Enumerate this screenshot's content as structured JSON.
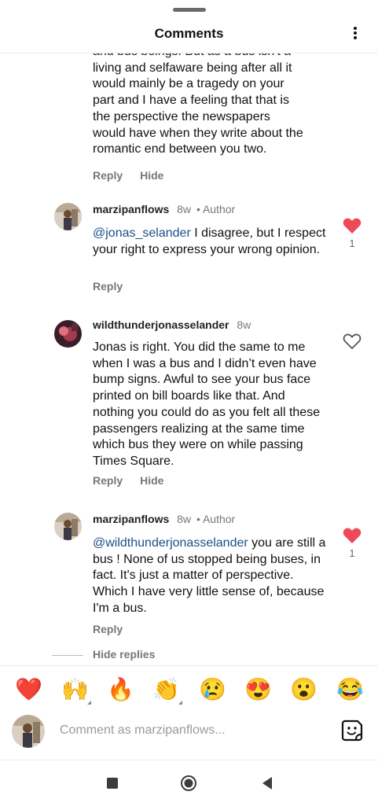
{
  "header": {
    "title": "Comments"
  },
  "continued_comment": {
    "lines": [
      "and bus beings. But as a bus isn't a",
      "living and selfaware being after all it",
      "would mainly be a tragedy on your",
      "part and I have a feeling that that is",
      "the perspective the newspapers",
      "would have when they write about the",
      "romantic end between you two."
    ],
    "reply_label": "Reply",
    "hide_label": "Hide"
  },
  "comments": [
    {
      "username": "marzipanflows",
      "time": "8w",
      "author_label": "Author",
      "mention": "@jonas_selander",
      "text": " I disagree, but I respect your right to express your wrong opinion.",
      "reply_label": "Reply",
      "liked": true,
      "like_count": "1"
    },
    {
      "username": "wildthunderjonasselander",
      "time": "8w",
      "text": "Jonas is right. You did the same to me when I was a bus and I didn’t even have bump signs. Awful to see your bus face printed on bill boards like that. And nothing you could do as you felt all these passengers realizing at the same time which bus they were on while passing Times Square.",
      "reply_label": "Reply",
      "hide_label": "Hide",
      "liked": false
    },
    {
      "username": "marzipanflows",
      "time": "8w",
      "author_label": "Author",
      "mention": "@wildthunderjonasselander",
      "text": " you are still a bus ! None of us stopped being buses, in fact. It's just a matter of perspective. Which I have very little sense of, because I'm a bus.",
      "reply_label": "Reply",
      "liked": true,
      "like_count": "1"
    }
  ],
  "hide_replies_label": "Hide replies",
  "emoji_bar": [
    {
      "icon": "red-heart",
      "glyph": "❤️",
      "variants": false
    },
    {
      "icon": "raising-hands",
      "glyph": "🙌",
      "variants": true
    },
    {
      "icon": "fire",
      "glyph": "🔥",
      "variants": false
    },
    {
      "icon": "clapping-hands",
      "glyph": "👏",
      "variants": true
    },
    {
      "icon": "crying-face",
      "glyph": "😢",
      "variants": false
    },
    {
      "icon": "heart-eyes",
      "glyph": "😍",
      "variants": false
    },
    {
      "icon": "surprised-face",
      "glyph": "😮",
      "variants": false
    },
    {
      "icon": "tears-of-joy",
      "glyph": "😂",
      "variants": false
    }
  ],
  "comment_input": {
    "placeholder": "Comment as marzipanflows..."
  },
  "colors": {
    "like_red": "#ed4956",
    "mention_blue": "#1b4f8a",
    "muted": "#777777"
  }
}
